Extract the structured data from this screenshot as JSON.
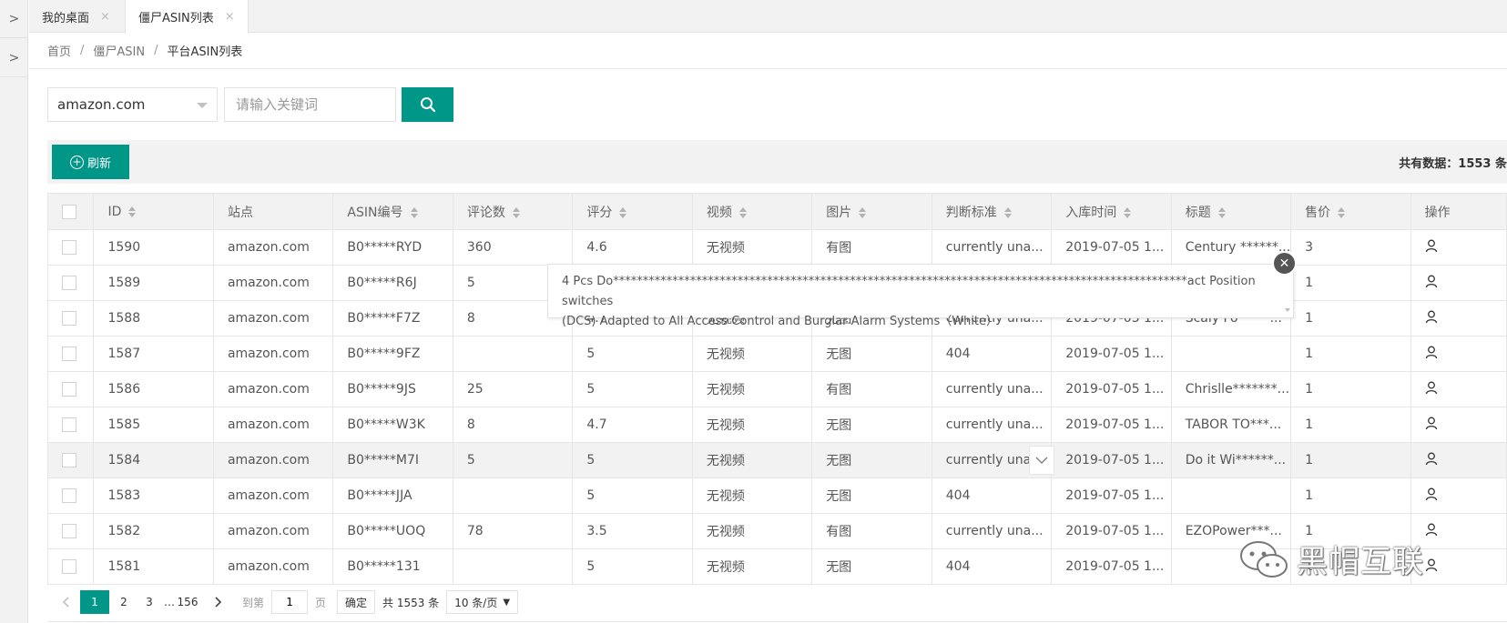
{
  "tabs": [
    {
      "label": "我的桌面",
      "close": "×"
    },
    {
      "label": "僵尸ASIN列表",
      "close": "×"
    }
  ],
  "breadcrumb": [
    "首页",
    "僵尸ASIN",
    "平台ASIN列表"
  ],
  "filters": {
    "site_selected": "amazon.com",
    "keyword_placeholder": "请输入关键词"
  },
  "toolbar": {
    "refresh_label": "刷新",
    "total_label": "共有数据：1553 条"
  },
  "table": {
    "columns": [
      "ID",
      "站点",
      "ASIN编号",
      "评论数",
      "评分",
      "视频",
      "图片",
      "判断标准",
      "入库时间",
      "标题",
      "售价",
      "操作"
    ],
    "rows": [
      {
        "id": "1590",
        "site": "amazon.com",
        "asin": "B0*****RYD",
        "reviews": "360",
        "rating": "4.6",
        "video": "无视频",
        "image": "有图",
        "criteria": "currently una...",
        "time": "2019-07-05 1...",
        "title": "Century ******...",
        "price": "3"
      },
      {
        "id": "1589",
        "site": "amazon.com",
        "asin": "B0*****R6J",
        "reviews": "5",
        "rating": "",
        "video": "",
        "image": "",
        "criteria": "",
        "time": "",
        "title": "",
        "price": "1"
      },
      {
        "id": "1588",
        "site": "amazon.com",
        "asin": "B0*****F7Z",
        "reviews": "8",
        "rating": "4.7",
        "video": "无视频",
        "image": "无图",
        "criteria": "currently una...",
        "time": "2019-07-05 1...",
        "title": "Scaly Fo*****...",
        "price": "1"
      },
      {
        "id": "1587",
        "site": "amazon.com",
        "asin": "B0*****9FZ",
        "reviews": "",
        "rating": "5",
        "video": "无视频",
        "image": "无图",
        "criteria": "404",
        "time": "2019-07-05 1...",
        "title": "",
        "price": "1"
      },
      {
        "id": "1586",
        "site": "amazon.com",
        "asin": "B0*****9JS",
        "reviews": "25",
        "rating": "5",
        "video": "无视频",
        "image": "有图",
        "criteria": "currently una...",
        "time": "2019-07-05 1...",
        "title": "Chrislle*******...",
        "price": "1"
      },
      {
        "id": "1585",
        "site": "amazon.com",
        "asin": "B0*****W3K",
        "reviews": "8",
        "rating": "4.7",
        "video": "无视频",
        "image": "无图",
        "criteria": "currently una...",
        "time": "2019-07-05 1...",
        "title": "TABOR TO***...",
        "price": "1"
      },
      {
        "id": "1584",
        "site": "amazon.com",
        "asin": "B0*****M7I",
        "reviews": "5",
        "rating": "5",
        "video": "无视频",
        "image": "无图",
        "criteria": "currently una...",
        "time": "2019-07-05 1...",
        "title": "Do it Wi******...",
        "price": "1"
      },
      {
        "id": "1583",
        "site": "amazon.com",
        "asin": "B0*****JJA",
        "reviews": "",
        "rating": "5",
        "video": "无视频",
        "image": "无图",
        "criteria": "404",
        "time": "2019-07-05 1...",
        "title": "",
        "price": "1"
      },
      {
        "id": "1582",
        "site": "amazon.com",
        "asin": "B0*****UOQ",
        "reviews": "78",
        "rating": "3.5",
        "video": "无视频",
        "image": "有图",
        "criteria": "currently una...",
        "time": "2019-07-05 1...",
        "title": "EZOPower***...",
        "price": "1"
      },
      {
        "id": "1581",
        "site": "amazon.com",
        "asin": "B0*****131",
        "reviews": "",
        "rating": "5",
        "video": "无视频",
        "image": "无图",
        "criteria": "404",
        "time": "2019-07-05 1...",
        "title": "",
        "price": "1"
      }
    ]
  },
  "popup": {
    "line1": "4 Pcs Do*************************************************************************************************act Position switches",
    "line2": "(DCS) Adapted to All Access Control and Burglar Alarm Systems（White）",
    "close": "✕"
  },
  "pagination": {
    "pages": [
      "1",
      "2",
      "3"
    ],
    "ellipsis": "…",
    "last": "156",
    "goto_label": "到第",
    "goto_value": "1",
    "page_unit": "页",
    "confirm": "确定",
    "total": "共 1553 条",
    "page_size": "10 条/页"
  },
  "watermark": "黑帽互联",
  "colors": {
    "accent": "#009688",
    "header_bg": "#f2f2f2",
    "border": "#e6e6e6"
  },
  "icons": {
    "rail": "chevron-right-icon",
    "search": "search-icon",
    "action": "user-icon"
  }
}
